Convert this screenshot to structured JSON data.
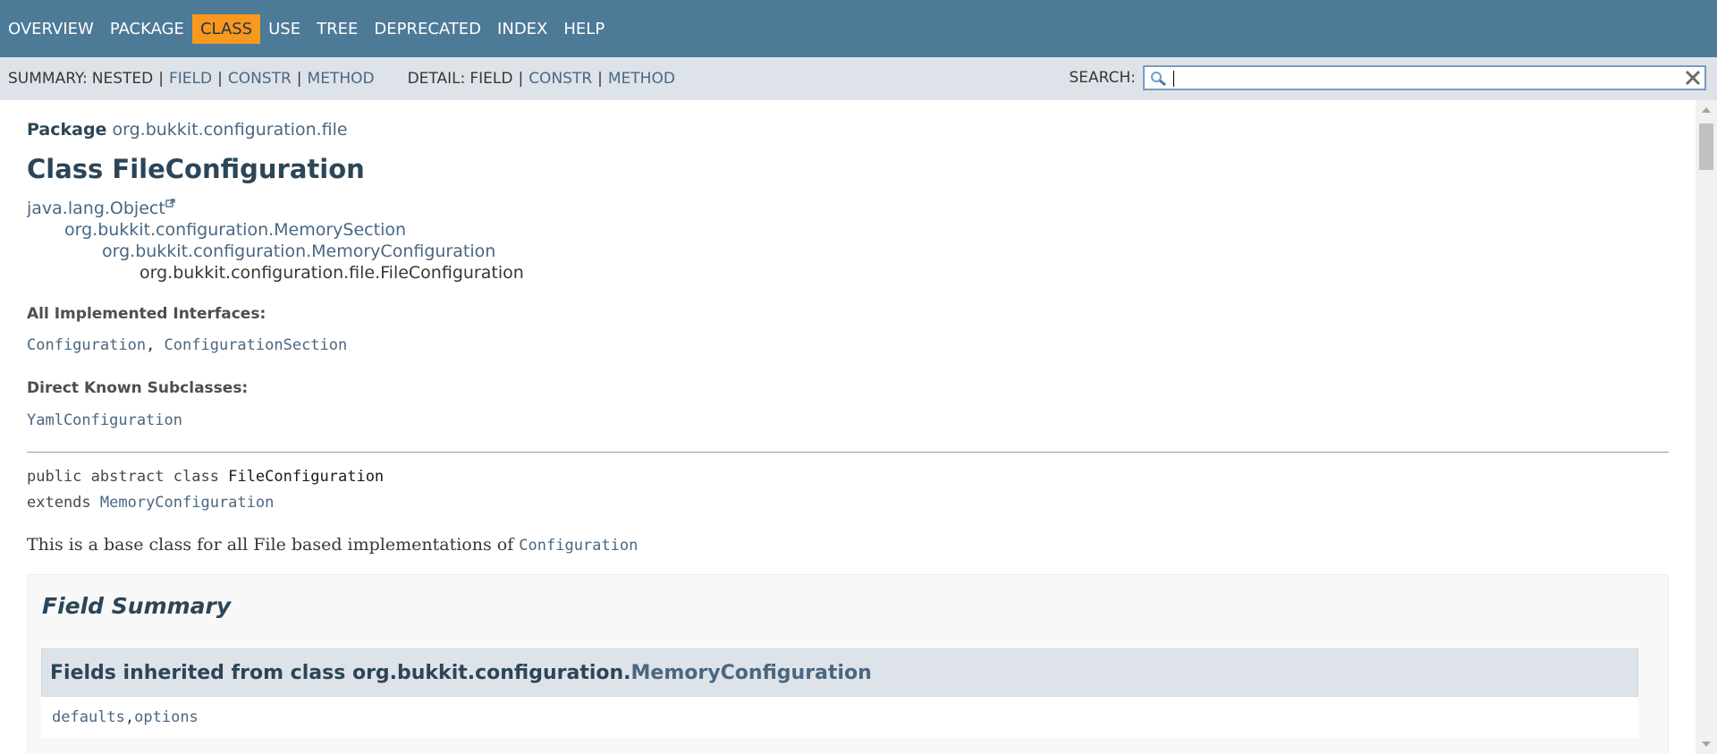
{
  "topnav": {
    "items": [
      "OVERVIEW",
      "PACKAGE",
      "CLASS",
      "USE",
      "TREE",
      "DEPRECATED",
      "INDEX",
      "HELP"
    ],
    "active": "CLASS"
  },
  "subnav": {
    "summary_label": "SUMMARY:",
    "summary_nested": "NESTED",
    "summary_field": "FIELD",
    "summary_constr": "CONSTR",
    "summary_method": "METHOD",
    "detail_label": "DETAIL:",
    "detail_field": "FIELD",
    "detail_constr": "CONSTR",
    "detail_method": "METHOD",
    "separator": "|",
    "search_label": "SEARCH:",
    "search_value": ""
  },
  "header": {
    "package_label": "Package",
    "package_name": "org.bukkit.configuration.file",
    "title": "Class FileConfiguration"
  },
  "inheritance": [
    "java.lang.Object",
    "org.bukkit.configuration.MemorySection",
    "org.bukkit.configuration.MemoryConfiguration",
    "org.bukkit.configuration.file.FileConfiguration"
  ],
  "interfaces": {
    "label": "All Implemented Interfaces:",
    "items": [
      "Configuration",
      "ConfigurationSection"
    ],
    "separator": ", "
  },
  "subclasses": {
    "label": "Direct Known Subclasses:",
    "items": [
      "YamlConfiguration"
    ]
  },
  "signature": {
    "modifiers": "public abstract class ",
    "name": "FileConfiguration",
    "extends_kw": "extends ",
    "extends_name": "MemoryConfiguration"
  },
  "description": {
    "text": "This is a base class for all File based implementations of ",
    "link": "Configuration"
  },
  "field_summary": {
    "title": "Field Summary",
    "inherited_prefix": "Fields inherited from class org.bukkit.configuration.",
    "inherited_class": "MemoryConfiguration",
    "fields": [
      "defaults",
      "options"
    ],
    "separator": ", "
  }
}
